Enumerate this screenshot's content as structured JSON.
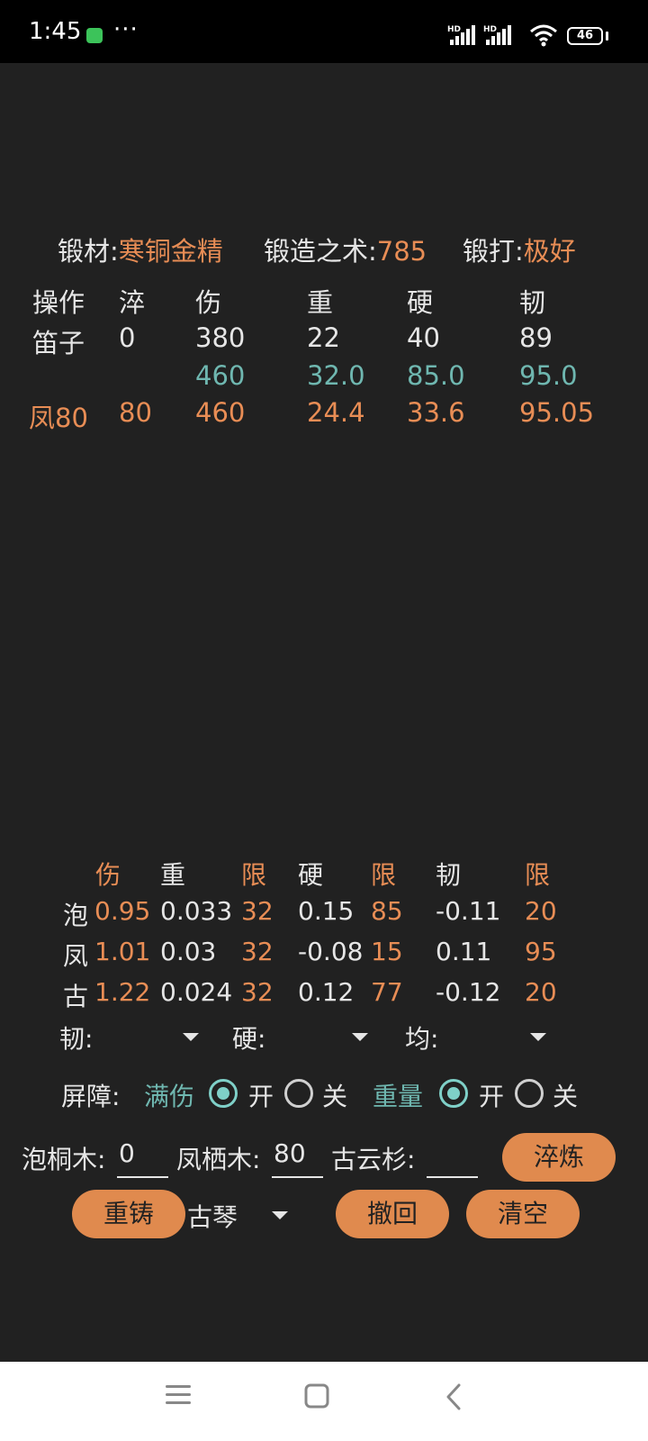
{
  "status_bar": {
    "time": "1:45",
    "dots": "···",
    "signal1": "HD",
    "signal2": "HD",
    "battery": "46"
  },
  "header": {
    "material_label": "锻材:",
    "material_value": "寒铜金精",
    "skill_label": "锻造之术:",
    "skill_value": "785",
    "forge_label": "锻打:",
    "forge_value": "极好"
  },
  "stats_table": {
    "headers": [
      "操作",
      "淬",
      "伤",
      "重",
      "硬",
      "韧"
    ],
    "row1": [
      "笛子",
      "0",
      "380",
      "22",
      "40",
      "89"
    ],
    "row2": [
      "",
      "",
      "460",
      "32.0",
      "85.0",
      "95.0"
    ],
    "row3": [
      "凤80",
      "80",
      "460",
      "24.4",
      "33.6",
      "95.05"
    ]
  },
  "coef_table": {
    "headers": [
      "伤",
      "重",
      "限",
      "硬",
      "限",
      "韧",
      "限"
    ],
    "rows": [
      [
        "泡",
        "0.95",
        "0.033",
        "32",
        "0.15",
        "85",
        "-0.11",
        "20"
      ],
      [
        "凤",
        "1.01",
        "0.03",
        "32",
        "-0.08",
        "15",
        "0.11",
        "95"
      ],
      [
        "古",
        "1.22",
        "0.024",
        "32",
        "0.12",
        "77",
        "-0.12",
        "20"
      ]
    ]
  },
  "filters": {
    "tough_label": "韧:",
    "hard_label": "硬:",
    "even_label": "均:"
  },
  "barrier": {
    "label": "屏障:",
    "full_damage": "满伤",
    "on1": "开",
    "off1": "关",
    "weight": "重量",
    "on2": "开",
    "off2": "关"
  },
  "inputs": {
    "paulownia_label": "泡桐木:",
    "paulownia_value": "0",
    "phoenix_label": "凤栖木:",
    "phoenix_value": "80",
    "fir_label": "古云杉:",
    "fir_value": ""
  },
  "buttons": {
    "quench": "淬炼",
    "recast": "重铸",
    "undo": "撤回",
    "clear": "清空"
  },
  "weapon_select": {
    "value": "古琴"
  },
  "colors": {
    "accent": "#e08a4e",
    "teal": "#6fb7b0",
    "radio": "#7fd0c8",
    "background": "#212121"
  }
}
